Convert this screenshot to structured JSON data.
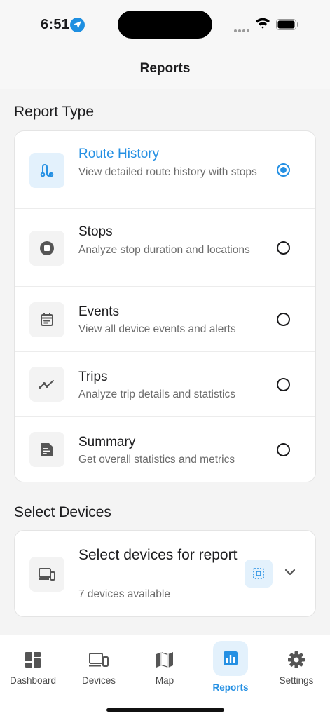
{
  "status": {
    "time": "6:51"
  },
  "header": {
    "title": "Reports"
  },
  "report_section": {
    "title": "Report Type",
    "items": [
      {
        "title": "Route History",
        "desc": "View detailed route history with stops",
        "icon": "route-icon",
        "selected": true
      },
      {
        "title": "Stops",
        "desc": "Analyze stop duration and locations",
        "icon": "stop-icon",
        "selected": false
      },
      {
        "title": "Events",
        "desc": "View all device events and alerts",
        "icon": "calendar-icon",
        "selected": false
      },
      {
        "title": "Trips",
        "desc": "Analyze trip details and statistics",
        "icon": "trend-icon",
        "selected": false
      },
      {
        "title": "Summary",
        "desc": "Get overall statistics and metrics",
        "icon": "summary-document-icon",
        "selected": false
      }
    ]
  },
  "device_section": {
    "title": "Select Devices",
    "card_title": "Select devices for report",
    "subtitle": "7 devices available"
  },
  "tabs": [
    {
      "label": "Dashboard",
      "icon": "dashboard-icon",
      "active": false
    },
    {
      "label": "Devices",
      "icon": "devices-icon",
      "active": false
    },
    {
      "label": "Map",
      "icon": "map-icon",
      "active": false
    },
    {
      "label": "Reports",
      "icon": "bar-chart-icon",
      "active": true
    },
    {
      "label": "Settings",
      "icon": "gear-icon",
      "active": false
    }
  ],
  "colors": {
    "accent": "#2590e3",
    "accent_bg": "#e3f1fc",
    "text": "#1c1c1e",
    "muted": "#6b6b6b"
  }
}
